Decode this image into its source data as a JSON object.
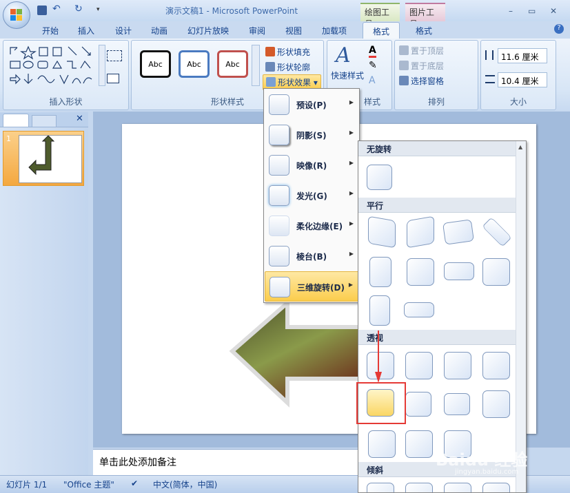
{
  "window": {
    "title": "演示文稿1 - Microsoft PowerPoint",
    "minimize": "–",
    "restore": "▭",
    "close": "✕"
  },
  "context_tabs": {
    "drawing_tools": "绘图工具",
    "picture_tools": "图片工具"
  },
  "tabs": [
    "开始",
    "插入",
    "设计",
    "动画",
    "幻灯片放映",
    "审阅",
    "视图",
    "加载项",
    "格式",
    "格式"
  ],
  "ribbon": {
    "insert_shapes": {
      "label": "插入形状"
    },
    "shape_styles": {
      "label": "形状样式",
      "swatch_text": "Abc",
      "fill": "形状填充",
      "outline": "形状轮廓",
      "effects": "形状效果"
    },
    "wordart": {
      "quick_styles": "快速样式",
      "label_tail": "样式"
    },
    "arrange": {
      "label": "排列",
      "bring_front": "置于顶层",
      "send_back": "置于底层",
      "selection_pane": "选择窗格"
    },
    "size": {
      "label": "大小",
      "height": "11.6 厘米",
      "width": "10.4 厘米"
    }
  },
  "effects_menu": [
    {
      "label": "预设(P)"
    },
    {
      "label": "阴影(S)"
    },
    {
      "label": "映像(R)"
    },
    {
      "label": "发光(G)"
    },
    {
      "label": "柔化边缘(E)"
    },
    {
      "label": "棱台(B)"
    },
    {
      "label": "三维旋转(D)"
    }
  ],
  "rotation_gallery": {
    "no_rotation": "无旋转",
    "parallel": "平行",
    "perspective": "透视",
    "oblique": "倾斜"
  },
  "slides_pane": {
    "slide_number": "1"
  },
  "notes": {
    "placeholder": "单击此处添加备注"
  },
  "status": {
    "slide": "幻灯片 1/1",
    "theme": "\"Office 主题\"",
    "language": "中文(简体，中国)"
  },
  "watermark": {
    "brand": "Baidu 经验",
    "url": "jingyan.baidu.com"
  },
  "colors": {
    "accent_orange": "#f4a840",
    "selection_red": "#e53935",
    "ribbon_blue": "#dbe8f7"
  }
}
